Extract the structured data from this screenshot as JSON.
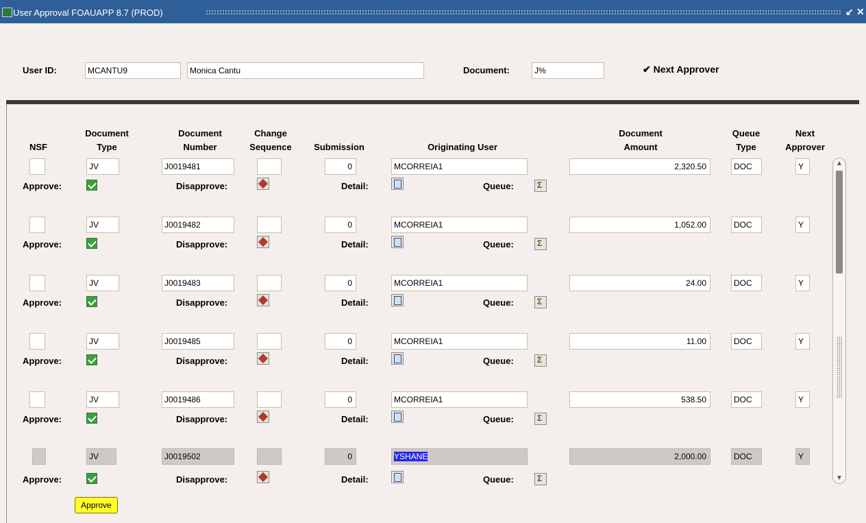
{
  "window": {
    "title": "User Approval  FOAUAPP 8.7  (PROD)",
    "min_icon": "minimize-icon",
    "close_icon": "close-icon"
  },
  "key_block": {
    "user_id_label": "User ID:",
    "user_id": "MCANTU9",
    "user_name": "Monica Cantu",
    "document_label": "Document:",
    "document": "J%",
    "next_approver_label": "Next Approver",
    "next_approver_checked": true
  },
  "headers": {
    "nsf": "NSF",
    "doc_type": [
      "Document",
      "Type"
    ],
    "doc_number": [
      "Document",
      "Number"
    ],
    "change_seq": [
      "Change",
      "Sequence"
    ],
    "submission": "Submission",
    "orig_user": "Originating User",
    "doc_amount": [
      "Document",
      "Amount"
    ],
    "queue_type": [
      "Queue",
      "Type"
    ],
    "next_approver": [
      "Next",
      "Approver"
    ]
  },
  "row_labels": {
    "approve": "Approve:",
    "disapprove": "Disapprove:",
    "detail": "Detail:",
    "queue": "Queue:"
  },
  "rows": [
    {
      "nsf": "",
      "doc_type": "JV",
      "doc_number": "J0019481",
      "change_seq": "",
      "submission": "0",
      "orig_user": "MCORREIA1",
      "amount": "2,320.50",
      "queue_type": "DOC",
      "next_approver": "Y"
    },
    {
      "nsf": "",
      "doc_type": "JV",
      "doc_number": "J0019482",
      "change_seq": "",
      "submission": "0",
      "orig_user": "MCORREIA1",
      "amount": "1,052.00",
      "queue_type": "DOC",
      "next_approver": "Y"
    },
    {
      "nsf": "",
      "doc_type": "JV",
      "doc_number": "J0019483",
      "change_seq": "",
      "submission": "0",
      "orig_user": "MCORREIA1",
      "amount": "24.00",
      "queue_type": "DOC",
      "next_approver": "Y"
    },
    {
      "nsf": "",
      "doc_type": "JV",
      "doc_number": "J0019485",
      "change_seq": "",
      "submission": "0",
      "orig_user": "MCORREIA1",
      "amount": "11.00",
      "queue_type": "DOC",
      "next_approver": "Y"
    },
    {
      "nsf": "",
      "doc_type": "JV",
      "doc_number": "J0019486",
      "change_seq": "",
      "submission": "0",
      "orig_user": "MCORREIA1",
      "amount": "538.50",
      "queue_type": "DOC",
      "next_approver": "Y"
    },
    {
      "nsf": "",
      "doc_type": "JV",
      "doc_number": "J0019502",
      "change_seq": "",
      "submission": "0",
      "orig_user": "YSHANE",
      "amount": "2,000.00",
      "queue_type": "DOC",
      "next_approver": "Y"
    }
  ],
  "approve_button": "Approve"
}
